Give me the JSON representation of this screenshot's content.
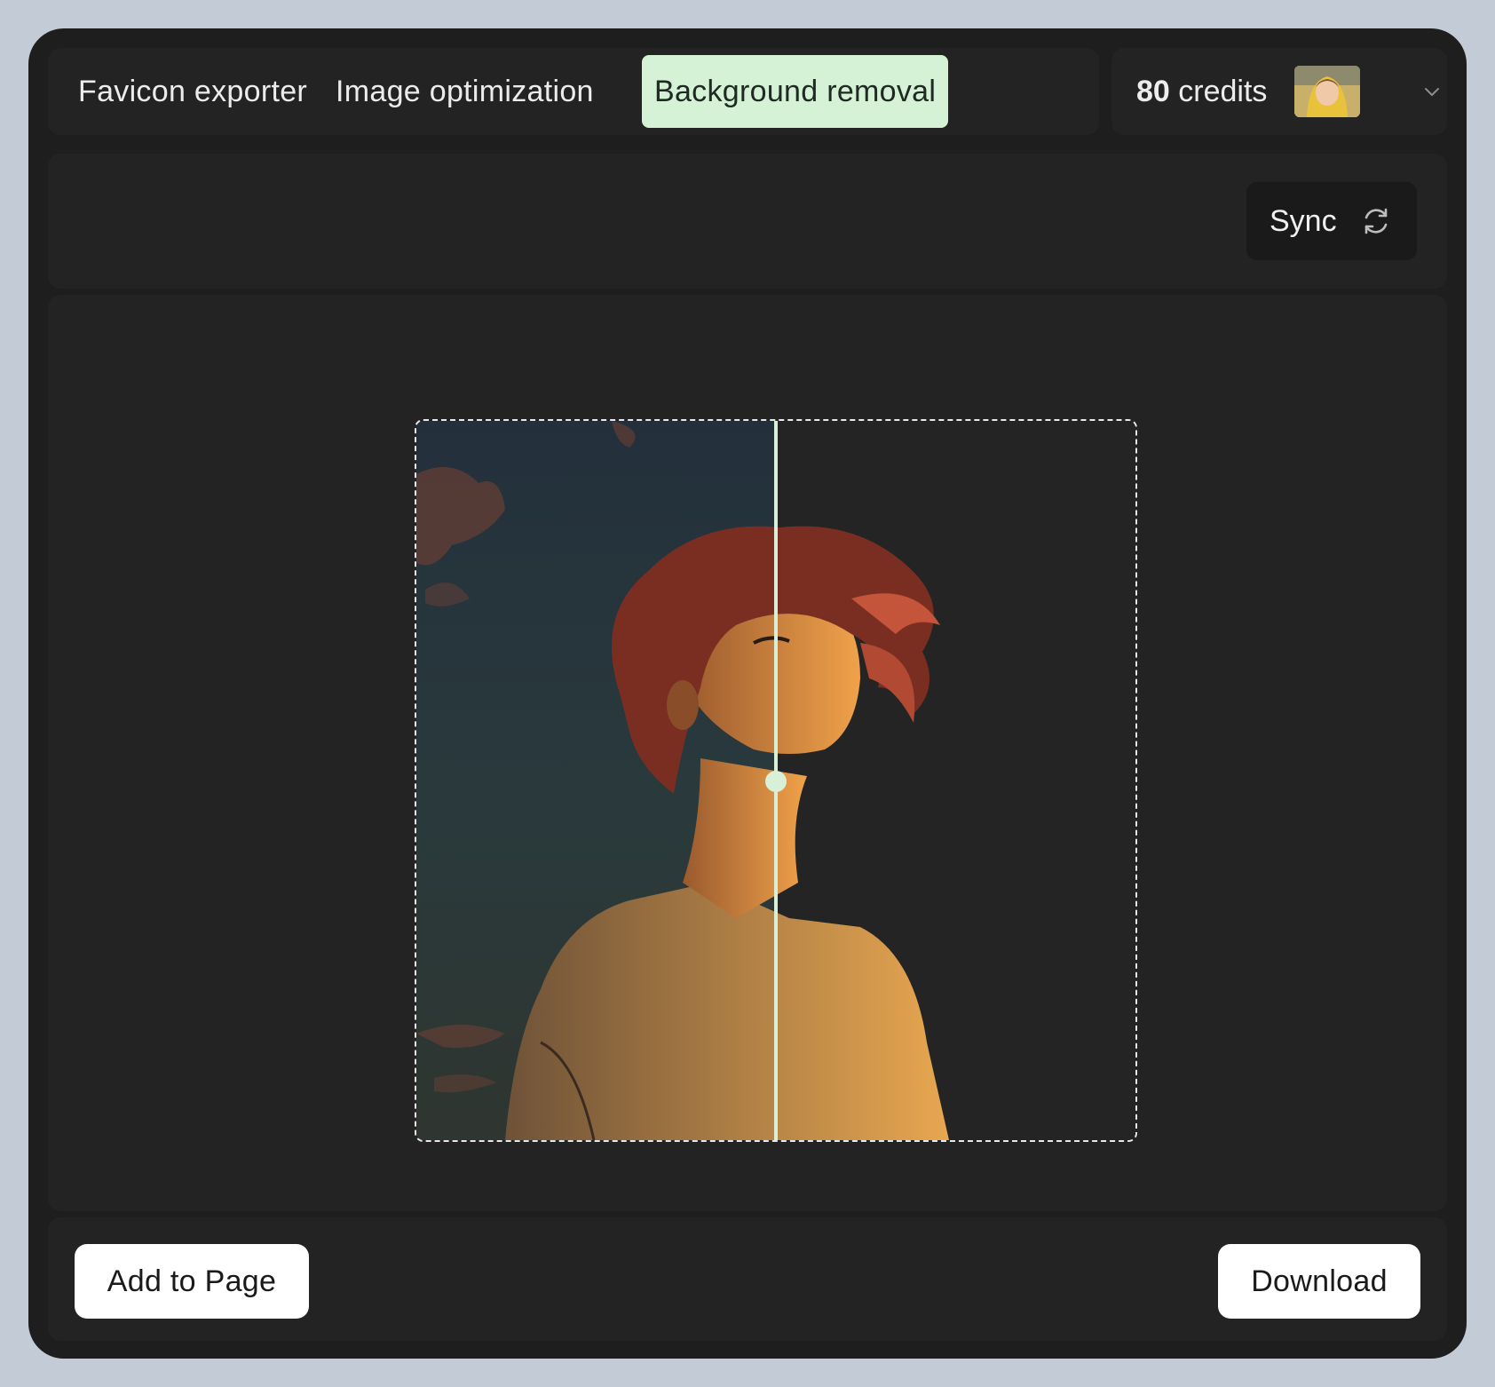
{
  "tabs": [
    {
      "label": "Favicon exporter",
      "active": false
    },
    {
      "label": "Image optimization",
      "active": false
    },
    {
      "label": "Background removal",
      "active": true
    }
  ],
  "account": {
    "credits_value": "80",
    "credits_label": " credits",
    "avatar_icon": "user-avatar",
    "dropdown_icon": "chevron-down-icon"
  },
  "toolbar": {
    "sync_label": "Sync",
    "sync_icon": "refresh-icon"
  },
  "compare_slider": {
    "position": 0.5
  },
  "footer": {
    "add_label": "Add to Page",
    "download_label": "Download"
  },
  "colors": {
    "active_tab_bg": "#d5f1d6",
    "slider_accent": "#d8f0d8",
    "surface": "#232324",
    "background": "#1e1e1f"
  }
}
